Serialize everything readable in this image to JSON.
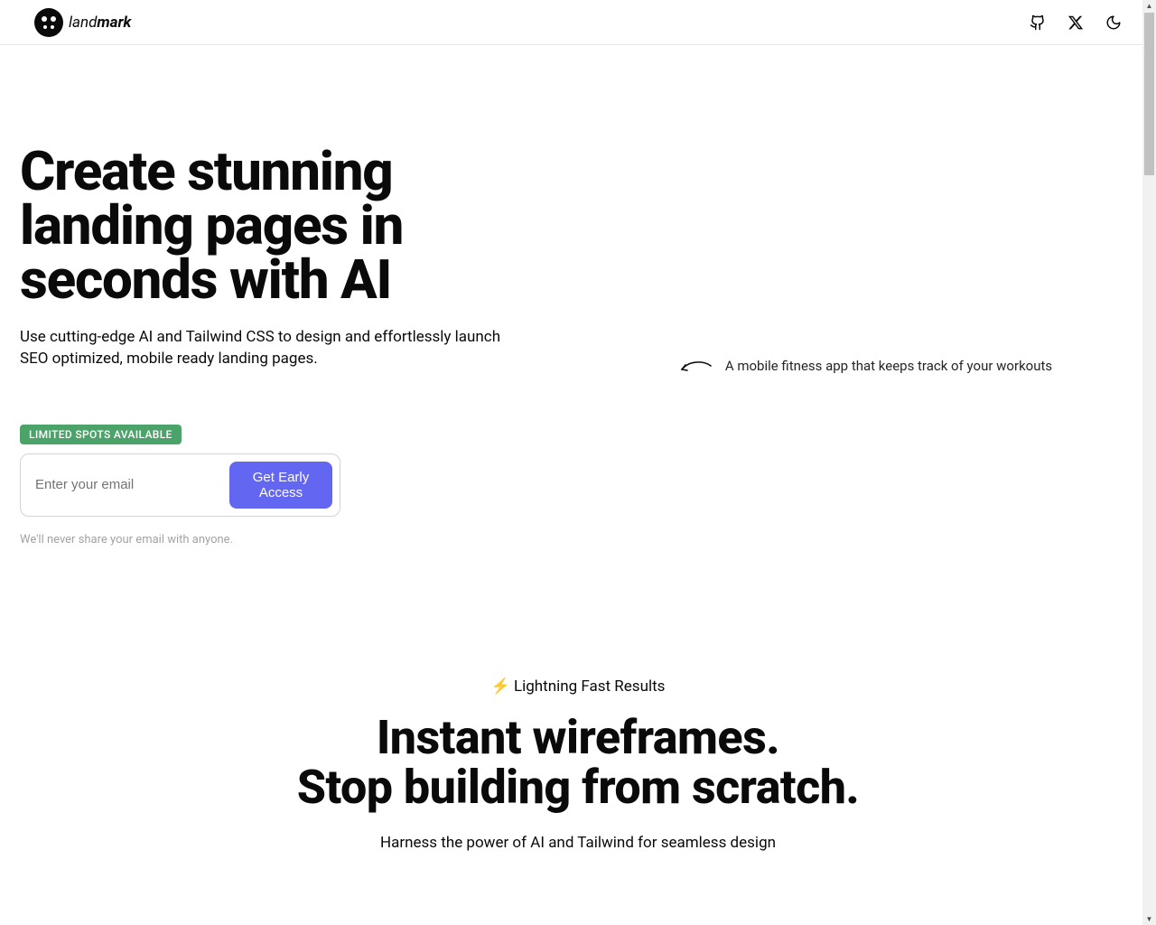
{
  "header": {
    "brand_light": "land",
    "brand_bold": "mark"
  },
  "hero": {
    "title": "Create stunning landing pages in seconds with AI",
    "subtitle": "Use cutting-edge AI and Tailwind CSS to design and effortlessly launch SEO optimized, mobile ready landing pages.",
    "badge": "LIMITED SPOTS AVAILABLE",
    "email_placeholder": "Enter your email",
    "cta_label": "Get Early Access",
    "privacy_note": "We'll never share your email with anyone.",
    "example_prompt": "A mobile fitness app that keeps track of your workouts"
  },
  "features": {
    "eyebrow": "⚡ Lightning Fast Results",
    "title_line1": "Instant wireframes.",
    "title_line2": "Stop building from scratch.",
    "subtitle": "Harness the power of AI and Tailwind for seamless design"
  }
}
